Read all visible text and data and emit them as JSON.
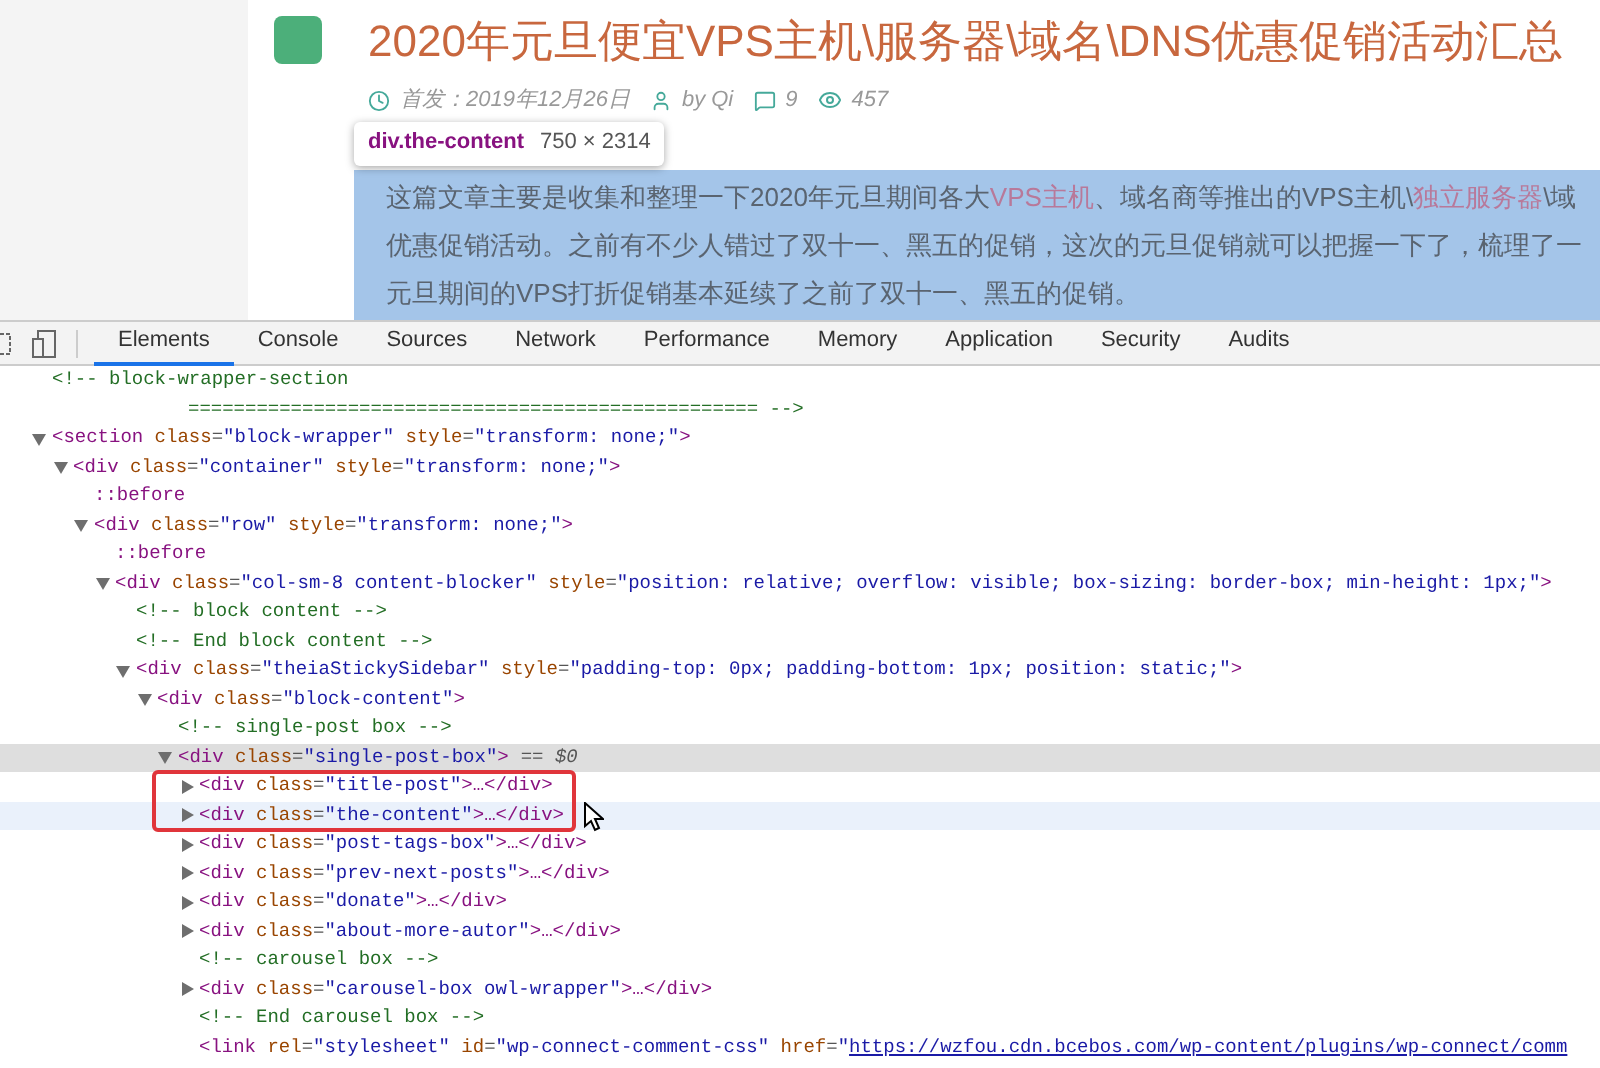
{
  "article": {
    "title": "2020年元旦便宜VPS主机\\服务器\\域名\\DNS优惠促销活动汇总",
    "meta": [
      {
        "kind": "date",
        "text": "首发：2019年12月26日"
      },
      {
        "kind": "author",
        "text": "by Qi"
      },
      {
        "kind": "comments",
        "text": "9"
      },
      {
        "kind": "views",
        "text": "457"
      }
    ],
    "tooltip": {
      "selector": "div.the-content",
      "size": "750 × 2314"
    },
    "lines": [
      [
        {
          "kind": "text",
          "text": "这篇文章主要是收集和整理一下2020年元旦期间各大"
        },
        {
          "kind": "link",
          "text": "VPS主机"
        },
        {
          "kind": "text",
          "text": "、域名商等推出的VPS主机\\"
        },
        {
          "kind": "link",
          "text": "独立服务器"
        },
        {
          "kind": "text",
          "text": "\\域"
        }
      ],
      [
        {
          "kind": "text",
          "text": "优惠促销活动。之前有不少人错过了双十一、黑五的促销，这次的元旦促销就可以把握一下了，梳理了一"
        }
      ],
      [
        {
          "kind": "text",
          "text": "元旦期间的VPS打折促销基本延续了之前了双十一、黑五的促销。"
        }
      ]
    ]
  },
  "devtools_tabs": [
    {
      "label": "Elements",
      "selected": true
    },
    {
      "label": "Console",
      "selected": false
    },
    {
      "label": "Sources",
      "selected": false
    },
    {
      "label": "Network",
      "selected": false
    },
    {
      "label": "Performance",
      "selected": false
    },
    {
      "label": "Memory",
      "selected": false
    },
    {
      "label": "Application",
      "selected": false
    },
    {
      "label": "Security",
      "selected": false
    },
    {
      "label": "Audits",
      "selected": false
    }
  ],
  "dom_tree": [
    {
      "kind": "comment",
      "lines": [
        "<!-- block-wrapper-section",
        "================================================== -->"
      ]
    },
    {
      "kind": "element",
      "text": "<section class=\"block-wrapper\" style=\"transform: none;\">",
      "expanded": true,
      "selected": false,
      "hovered": false,
      "children": [
        {
          "kind": "element",
          "text": "<div class=\"container\" style=\"transform: none;\">",
          "expanded": true,
          "selected": false,
          "hovered": false,
          "children": [
            {
              "kind": "pseudo",
              "text": "::before"
            },
            {
              "kind": "element",
              "text": "<div class=\"row\" style=\"transform: none;\">",
              "expanded": true,
              "selected": false,
              "hovered": false,
              "children": [
                {
                  "kind": "pseudo",
                  "text": "::before"
                },
                {
                  "kind": "element",
                  "text": "<div class=\"col-sm-8 content-blocker\" style=\"position: relative; overflow: visible; box-sizing: border-box; min-height: 1px;\">",
                  "expanded": true,
                  "selected": false,
                  "hovered": false,
                  "children": [
                    {
                      "kind": "comment",
                      "text": "<!-- block content -->"
                    },
                    {
                      "kind": "comment",
                      "text": "<!-- End block content -->"
                    },
                    {
                      "kind": "element",
                      "text": "<div class=\"theiaStickySidebar\" style=\"padding-top: 0px; padding-bottom: 1px; position: static;\">",
                      "expanded": true,
                      "selected": false,
                      "hovered": false,
                      "children": [
                        {
                          "kind": "element",
                          "text": "<div class=\"block-content\">",
                          "expanded": true,
                          "selected": false,
                          "hovered": false,
                          "children": [
                            {
                              "kind": "comment",
                              "text": "<!-- single-post box -->"
                            },
                            {
                              "kind": "element",
                              "text": "<div class=\"single-post-box\">",
                              "suffix": "== $0",
                              "expanded": true,
                              "selected": true,
                              "hovered": false,
                              "children": [
                                {
                                  "kind": "element",
                                  "text": "<div class=\"title-post\">",
                                  "tail": "…</div>",
                                  "expanded": false,
                                  "selected": false,
                                  "hovered": false
                                },
                                {
                                  "kind": "element",
                                  "text": "<div class=\"the-content\">",
                                  "tail": "…</div>",
                                  "expanded": false,
                                  "selected": false,
                                  "hovered": true
                                },
                                {
                                  "kind": "element",
                                  "text": "<div class=\"post-tags-box\">",
                                  "tail": "…</div>",
                                  "expanded": false,
                                  "selected": false,
                                  "hovered": false
                                },
                                {
                                  "kind": "element",
                                  "text": "<div class=\"prev-next-posts\">",
                                  "tail": "…</div>",
                                  "expanded": false,
                                  "selected": false,
                                  "hovered": false
                                },
                                {
                                  "kind": "element",
                                  "text": "<div class=\"donate\">",
                                  "tail": "…</div>",
                                  "expanded": false,
                                  "selected": false,
                                  "hovered": false
                                },
                                {
                                  "kind": "element",
                                  "text": "<div class=\"about-more-autor\">",
                                  "tail": "…</div>",
                                  "expanded": false,
                                  "selected": false,
                                  "hovered": false
                                },
                                {
                                  "kind": "comment",
                                  "text": "<!-- carousel box -->"
                                },
                                {
                                  "kind": "element",
                                  "text": "<div class=\"carousel-box owl-wrapper\">",
                                  "tail": "…</div>",
                                  "expanded": false,
                                  "selected": false,
                                  "hovered": false
                                },
                                {
                                  "kind": "comment",
                                  "text": "<!-- End carousel box -->"
                                },
                                {
                                  "kind": "tag",
                                  "text": "<link rel=\"stylesheet\" id=\"wp-connect-comment-css\" href=\"",
                                  "link": "https://wzfou.cdn.bcebos.com/wp-content/plugins/wp-connect/comm"
                                }
                              ]
                            }
                          ]
                        }
                      ]
                    }
                  ]
                }
              ]
            }
          ]
        }
      ]
    }
  ]
}
